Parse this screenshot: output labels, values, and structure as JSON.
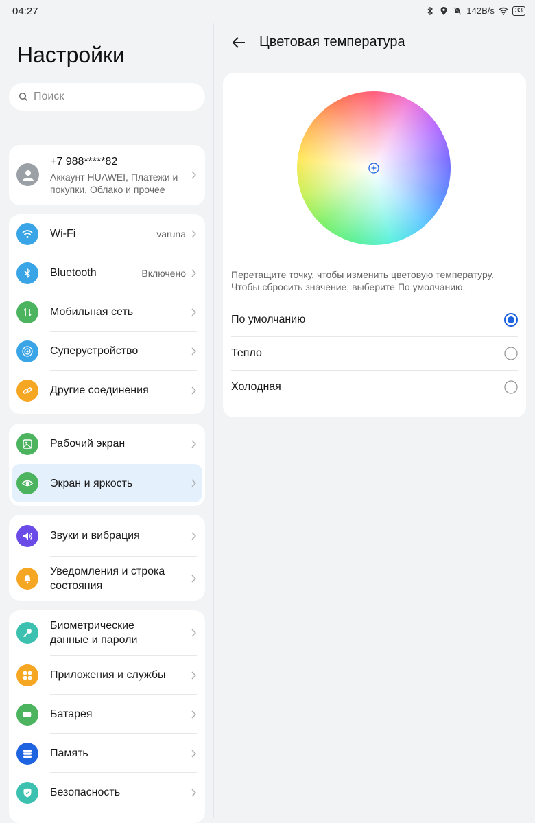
{
  "status": {
    "time": "04:27",
    "speed": "142B/s",
    "battery": "33"
  },
  "left": {
    "title": "Настройки",
    "search": {
      "placeholder": "Поиск"
    },
    "account": {
      "name": "+7 988*****82",
      "subtitle": "Аккаунт HUAWEI, Платежи и покупки, Облако и прочее"
    },
    "groups": [
      [
        {
          "label": "Wi-Fi",
          "value": "varuna",
          "icon": "wifi-icon",
          "color": "#3aa5e6"
        },
        {
          "label": "Bluetooth",
          "value": "Включено",
          "icon": "bluetooth-icon",
          "color": "#3aa5e6"
        },
        {
          "label": "Мобильная сеть",
          "value": "",
          "icon": "mobile-data-icon",
          "color": "#4cb35e"
        },
        {
          "label": "Суперустройство",
          "value": "",
          "icon": "superdevice-icon",
          "color": "#3aa5e6"
        },
        {
          "label": "Другие соединения",
          "value": "",
          "icon": "link-icon",
          "color": "#f5a623"
        }
      ],
      [
        {
          "label": "Рабочий экран",
          "value": "",
          "icon": "home-screen-icon",
          "color": "#4cb35e"
        },
        {
          "label": "Экран и яркость",
          "value": "",
          "icon": "eye-icon",
          "color": "#4cb35e",
          "selected": true
        }
      ],
      [
        {
          "label": "Звуки и вибрация",
          "value": "",
          "icon": "speaker-icon",
          "color": "#6a4be8"
        },
        {
          "label": "Уведомления и строка состояния",
          "value": "",
          "icon": "bell-icon",
          "color": "#f5a623"
        }
      ],
      [
        {
          "label": "Биометрические данные и пароли",
          "value": "",
          "icon": "key-icon",
          "color": "#3cc1b0"
        },
        {
          "label": "Приложения и службы",
          "value": "",
          "icon": "apps-icon",
          "color": "#f5a623"
        },
        {
          "label": "Батарея",
          "value": "",
          "icon": "battery-icon",
          "color": "#4cb35e"
        },
        {
          "label": "Память",
          "value": "",
          "icon": "storage-icon",
          "color": "#1e63e0"
        },
        {
          "label": "Безопасность",
          "value": "",
          "icon": "shield-icon",
          "color": "#3cc1b0"
        }
      ]
    ]
  },
  "right": {
    "title": "Цветовая температура",
    "hint": "Перетащите точку, чтобы изменить цветовую температуру. Чтобы сбросить значение, выберите По умолчанию.",
    "options": [
      {
        "label": "По умолчанию",
        "selected": true
      },
      {
        "label": "Тепло",
        "selected": false
      },
      {
        "label": "Холодная",
        "selected": false
      }
    ],
    "accent": "#1e63e0"
  }
}
